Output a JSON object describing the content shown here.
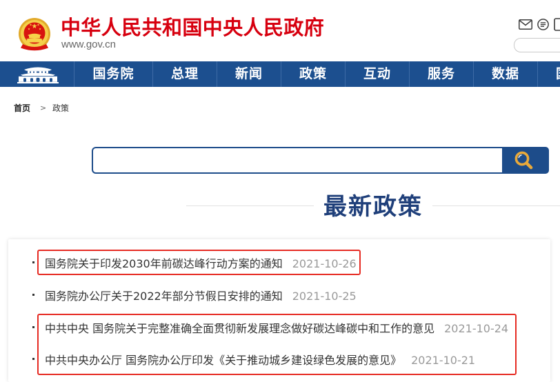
{
  "header": {
    "title": "中华人民共和国中央人民政府",
    "domain": "www.gov.cn",
    "emblem_icon": "national-emblem-icon",
    "utility_icons": [
      "mail-icon",
      "menu-circle-icon",
      "mobile-icon"
    ]
  },
  "nav": {
    "home_icon": "tiananmen-icon",
    "items": [
      "国务院",
      "总理",
      "新闻",
      "政策",
      "互动",
      "服务",
      "数据",
      "国"
    ]
  },
  "breadcrumb": {
    "home": "首页",
    "separator": ">",
    "current": "政策"
  },
  "search": {
    "button_icon": "search-icon"
  },
  "latest_policies": {
    "title": "最新政策",
    "items": [
      {
        "title": "国务院关于印发2030年前碳达峰行动方案的通知",
        "date": "2021-10-26",
        "highlighted": true
      },
      {
        "title": "国务院办公厅关于2022年部分节假日安排的通知",
        "date": "2021-10-25",
        "highlighted": false
      },
      {
        "title": "中共中央 国务院关于完整准确全面贯彻新发展理念做好碳达峰碳中和工作的意见",
        "date": "2021-10-24",
        "highlighted": true
      },
      {
        "title": "中共中央办公厅 国务院办公厅印发《关于推动城乡建设绿色发展的意见》",
        "date": "2021-10-21",
        "highlighted": true
      }
    ]
  },
  "colors": {
    "brand_red": "#d7000f",
    "nav_blue": "#1c4f8f",
    "heading_blue": "#1f3f7a",
    "search_icon_gold": "#e9a93a",
    "highlight_red": "#e62a22",
    "date_gray": "#999999"
  }
}
